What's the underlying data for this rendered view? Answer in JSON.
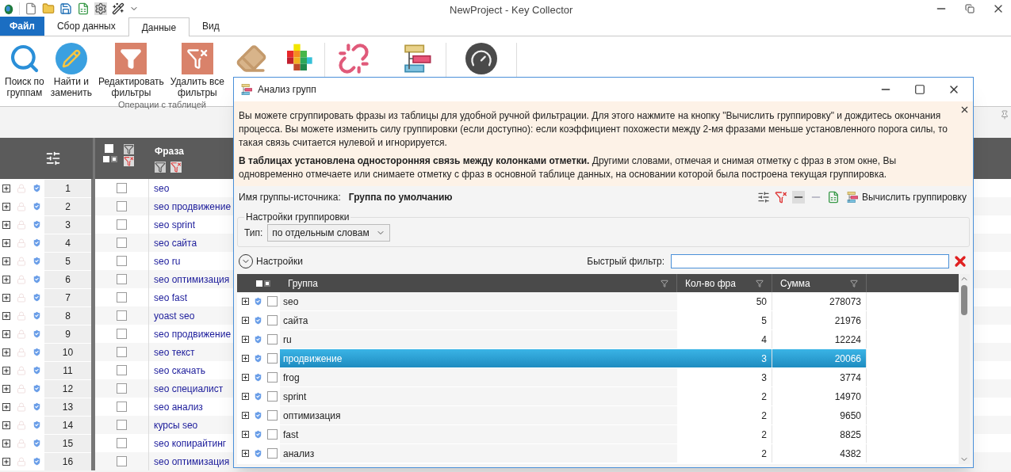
{
  "app": {
    "title": "NewProject - Key Collector"
  },
  "menu_tabs": [
    {
      "label": "Файл",
      "kind": "file",
      "selected": false
    },
    {
      "label": "Сбор данных",
      "kind": "tab",
      "selected": false
    },
    {
      "label": "Данные",
      "kind": "tab",
      "selected": true
    },
    {
      "label": "Вид",
      "kind": "tab",
      "selected": false
    }
  ],
  "ribbon": {
    "group_label": "Операции с таблицей",
    "buttons": [
      {
        "lines": [
          "Поиск по",
          "группам"
        ]
      },
      {
        "lines": [
          "Найти и",
          "заменить"
        ]
      },
      {
        "lines": [
          "Редактировать",
          "фильтры"
        ]
      },
      {
        "lines": [
          "Удалить все",
          "фильтры"
        ]
      }
    ]
  },
  "main_table": {
    "phrase_header": "Фраза",
    "rows": [
      {
        "number": "1",
        "phrase": "seo",
        "checked": false
      },
      {
        "number": "2",
        "phrase": "seo продвижение",
        "checked": false
      },
      {
        "number": "3",
        "phrase": "seo sprint",
        "checked": false
      },
      {
        "number": "4",
        "phrase": "seo сайта",
        "checked": false
      },
      {
        "number": "5",
        "phrase": "seo ru",
        "checked": false
      },
      {
        "number": "6",
        "phrase": "seo оптимизация",
        "checked": false
      },
      {
        "number": "7",
        "phrase": "seo fast",
        "checked": false
      },
      {
        "number": "8",
        "phrase": "yoast seo",
        "checked": false
      },
      {
        "number": "9",
        "phrase": "seo продвижение",
        "checked": false
      },
      {
        "number": "10",
        "phrase": "seo текст",
        "checked": false
      },
      {
        "number": "11",
        "phrase": "seo скачать",
        "checked": false
      },
      {
        "number": "12",
        "phrase": "seo специалист",
        "checked": false
      },
      {
        "number": "13",
        "phrase": "seo анализ",
        "checked": false
      },
      {
        "number": "14",
        "phrase": "курсы seo",
        "checked": false
      },
      {
        "number": "15",
        "phrase": "seo копирайтинг",
        "checked": false
      },
      {
        "number": "16",
        "phrase": "seo оптимизация",
        "checked": false
      }
    ]
  },
  "dialog": {
    "title": "Анализ групп",
    "info_paragraphs": [
      "Вы можете сгруппировать фразы из таблицы для удобной ручной фильтрации. Для этого нажмите на кнопку \"Вычислить группировку\" и дождитесь окончания процесса. Вы можете изменить силу группировки (если доступно): если коэффициент похожести между 2-мя фразами меньше установленного порога силы, то такая связь считается нулевой и игнорируется.",
      "**В таблицах установлена односторонняя связь между колонками отметки.** Другими словами, отмечая и снимая отметку с фраз в этом окне, Вы одновременно отмечаете или снимаете отметку с фраз в основной таблице данных, на основании которой была построена текущая группировка."
    ],
    "source_label": "Имя группы-источника:",
    "source_value": "Группа по умолчанию",
    "compute_button": "Вычислить группировку",
    "settings_legend": "Настройки группировки",
    "type_label": "Тип:",
    "type_value": "по отдельным словам",
    "settings_toggle": "Настройки",
    "quick_filter_label": "Быстрый фильтр:",
    "columns": [
      "Группа",
      "Кол-во фра",
      "Сумма"
    ],
    "rows": [
      {
        "group": "seo",
        "count": "50",
        "sum": "278073",
        "checked": false,
        "selected": false
      },
      {
        "group": "сайта",
        "count": "5",
        "sum": "21976",
        "checked": false,
        "selected": false
      },
      {
        "group": "ru",
        "count": "4",
        "sum": "12224",
        "checked": false,
        "selected": false
      },
      {
        "group": "продвижение",
        "count": "3",
        "sum": "20066",
        "checked": false,
        "selected": true
      },
      {
        "group": "frog",
        "count": "3",
        "sum": "3774",
        "checked": false,
        "selected": false
      },
      {
        "group": "sprint",
        "count": "2",
        "sum": "14970",
        "checked": false,
        "selected": false
      },
      {
        "group": "оптимизация",
        "count": "2",
        "sum": "9650",
        "checked": false,
        "selected": false
      },
      {
        "group": "fast",
        "count": "2",
        "sum": "8825",
        "checked": false,
        "selected": false
      },
      {
        "group": "анализ",
        "count": "2",
        "sum": "4382",
        "checked": false,
        "selected": false
      }
    ]
  }
}
